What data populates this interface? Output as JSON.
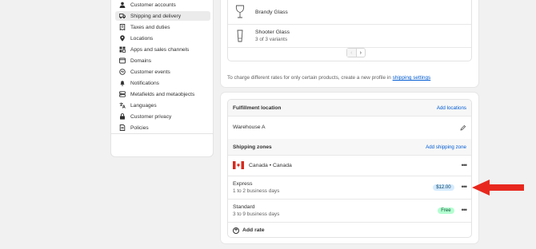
{
  "sidebar": {
    "items": [
      {
        "label": "Customer accounts",
        "icon": "person-icon"
      },
      {
        "label": "Shipping and delivery",
        "icon": "truck-icon",
        "active": true
      },
      {
        "label": "Taxes and duties",
        "icon": "receipt-icon"
      },
      {
        "label": "Locations",
        "icon": "location-pin-icon"
      },
      {
        "label": "Apps and sales channels",
        "icon": "apps-icon"
      },
      {
        "label": "Domains",
        "icon": "globe-icon"
      },
      {
        "label": "Customer events",
        "icon": "events-icon"
      },
      {
        "label": "Notifications",
        "icon": "bell-icon"
      },
      {
        "label": "Metafields and metaobjects",
        "icon": "database-icon"
      },
      {
        "label": "Languages",
        "icon": "translate-icon"
      },
      {
        "label": "Customer privacy",
        "icon": "lock-icon"
      },
      {
        "label": "Policies",
        "icon": "policy-icon"
      }
    ]
  },
  "products": {
    "items": [
      {
        "name": "Brandy Glass",
        "sub": ""
      },
      {
        "name": "Shooter Glass",
        "sub": "3 of 3 variants"
      }
    ],
    "pager": {
      "prev": "‹",
      "next": "›"
    },
    "note_text": "To charge different rates for only certain products, create a new profile in ",
    "note_link": "shipping settings"
  },
  "fulfillment": {
    "title": "Fulfillment location",
    "action": "Add locations",
    "location": "Warehouse A"
  },
  "zones": {
    "title": "Shipping zones",
    "action": "Add shipping zone",
    "zone_name": "Canada • Canada",
    "rates": [
      {
        "name": "Express",
        "time": "1 to 2 business days",
        "price": "$12.00"
      },
      {
        "name": "Standard",
        "time": "3 to 9 business days",
        "price": "Free"
      }
    ],
    "add_rate": "Add rate"
  },
  "colors": {
    "link": "#005bd3",
    "annotation_arrow": "#e8281e",
    "price_badge": "#d5ebff",
    "free_badge": "#b4fed2"
  }
}
